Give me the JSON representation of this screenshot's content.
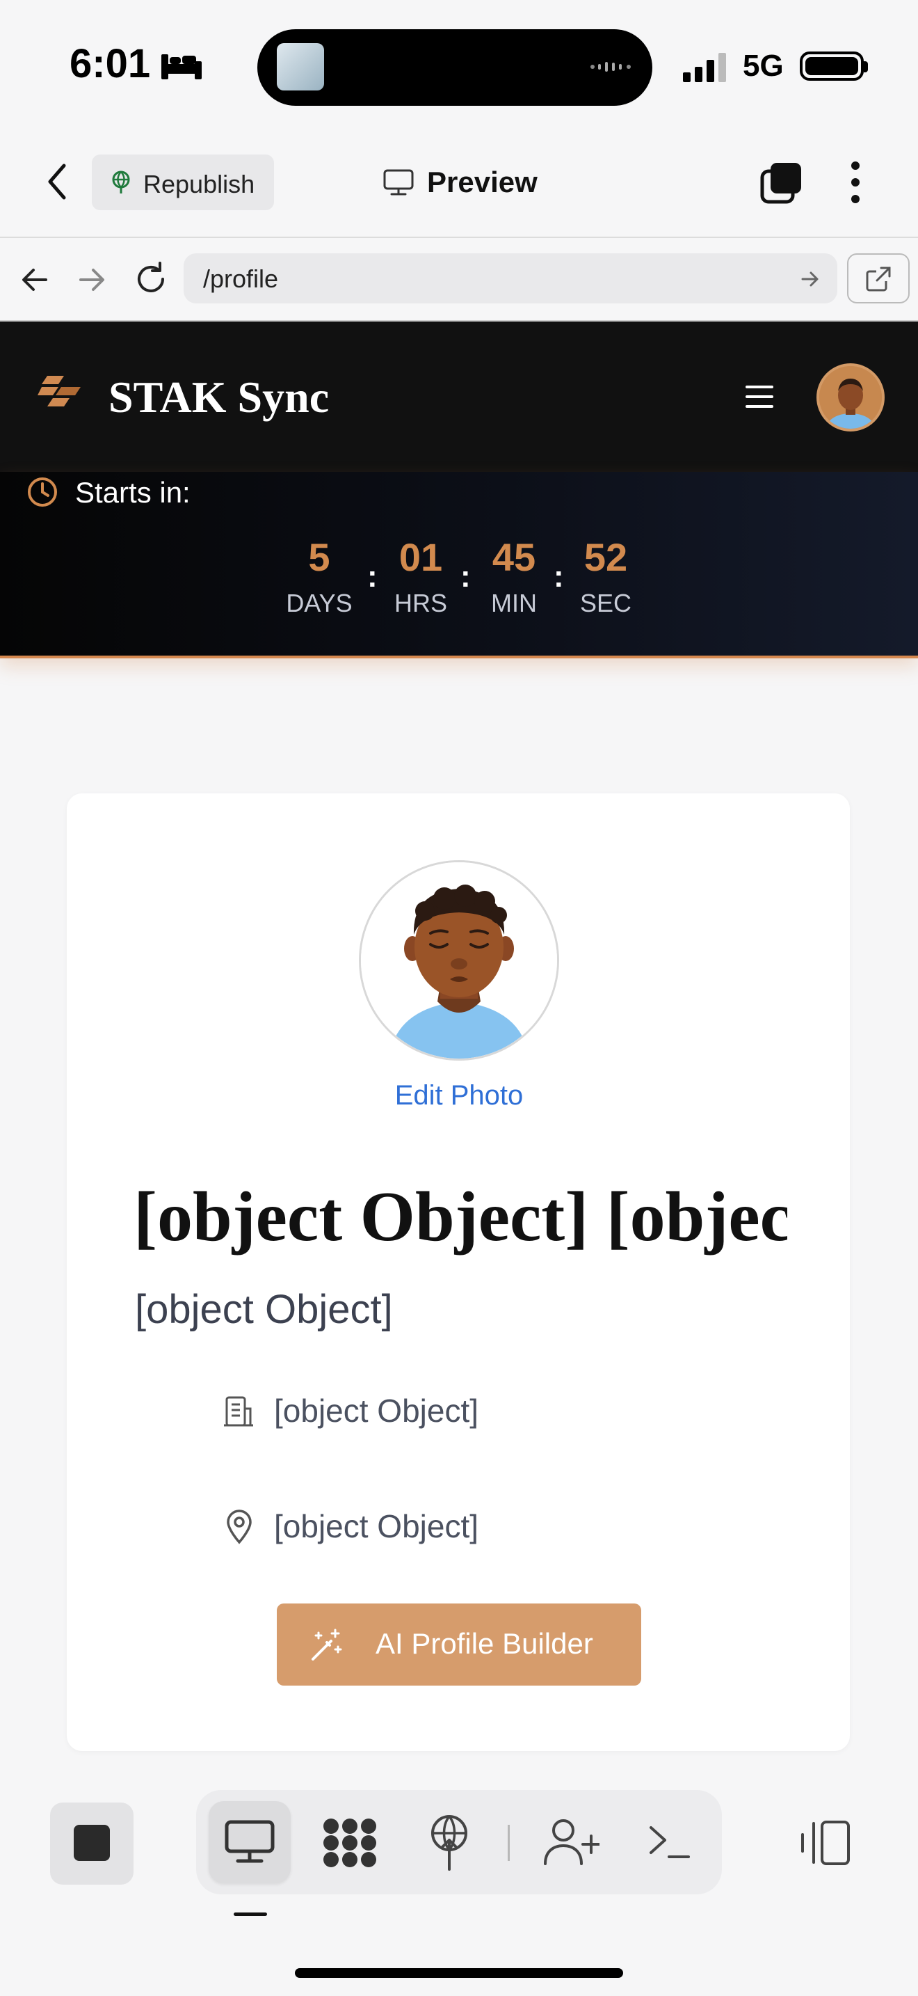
{
  "status_bar": {
    "time": "6:01",
    "network": "5G"
  },
  "toolbar": {
    "republish_label": "Republish",
    "preview_label": "Preview"
  },
  "url_bar": {
    "url": "/profile"
  },
  "site": {
    "brand": "STAK Sync"
  },
  "countdown": {
    "label": "Starts in:",
    "units": [
      {
        "value": "5",
        "unit": "DAYS"
      },
      {
        "value": "01",
        "unit": "HRS"
      },
      {
        "value": "45",
        "unit": "MIN"
      },
      {
        "value": "52",
        "unit": "SEC"
      }
    ],
    "separator": ":",
    "accent_color": "#d28a4e"
  },
  "profile": {
    "edit_photo": "Edit Photo",
    "name": "[object Object] [object Object]",
    "title": "[object Object]",
    "company": "[object Object]",
    "location": "[object Object]",
    "ai_button": "AI Profile Builder",
    "ai_button_color": "#d69c6c",
    "link_color": "#2f6fd6"
  },
  "icons": {
    "back": "chevron-left-icon",
    "republish": "globe-tree-icon",
    "preview": "monitor-icon",
    "tabs": "tabs-icon",
    "more": "more-vertical-icon",
    "clock": "clock-icon",
    "company": "building-icon",
    "location": "map-pin-icon",
    "ai": "magic-wand-icon"
  }
}
